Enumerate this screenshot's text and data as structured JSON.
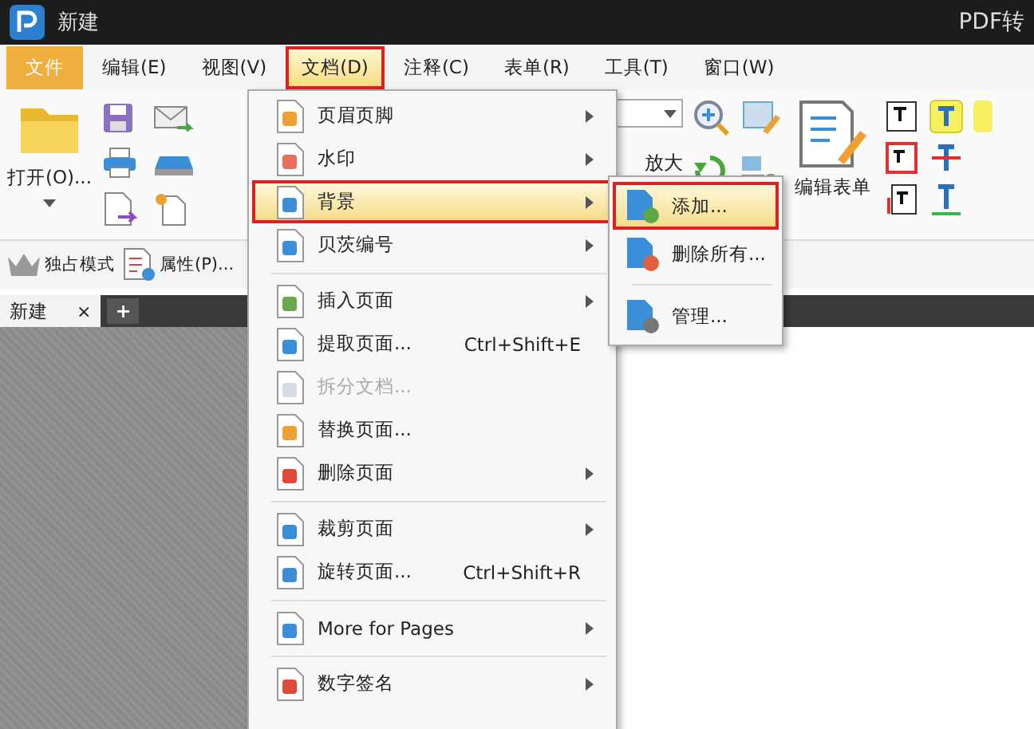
{
  "title_bar": {
    "title": "新建",
    "app_name": "PDF转"
  },
  "menu_bar": [
    {
      "label": "文件",
      "selected": false
    },
    {
      "label": "编辑(E)",
      "selected": false
    },
    {
      "label": "视图(V)",
      "selected": false
    },
    {
      "label": "文档(D)",
      "selected": true,
      "callout": true
    },
    {
      "label": "注释(C)",
      "selected": false
    },
    {
      "label": "表单(R)",
      "selected": false
    },
    {
      "label": "工具(T)",
      "selected": false
    },
    {
      "label": "窗口(W)",
      "selected": false
    }
  ],
  "ribbon": {
    "open_label": "打开(O)...",
    "zoom_label": "放大",
    "edit_form_label": "编辑表单"
  },
  "quick_bar": [
    {
      "label": "独占模式"
    },
    {
      "label": "属性(P)..."
    }
  ],
  "doc_tabs": [
    {
      "label": "新建",
      "selected": true,
      "close": "×"
    }
  ],
  "new_tab": "+",
  "document_menu": [
    {
      "kind": "item",
      "label": "页眉页脚",
      "submenu": true,
      "selected": false,
      "disabled": false
    },
    {
      "kind": "item",
      "label": "水印",
      "submenu": true,
      "selected": false,
      "disabled": false
    },
    {
      "kind": "item",
      "label": "背景",
      "submenu": true,
      "selected": true,
      "disabled": false,
      "callout": true
    },
    {
      "kind": "item",
      "label": "贝茨编号",
      "submenu": true,
      "selected": false,
      "disabled": false
    },
    {
      "kind": "separator"
    },
    {
      "kind": "item",
      "label": "插入页面",
      "submenu": true,
      "selected": false,
      "disabled": false
    },
    {
      "kind": "item",
      "label": "提取页面...",
      "shortcut": "Ctrl+Shift+E",
      "submenu": false,
      "selected": false,
      "disabled": false
    },
    {
      "kind": "item",
      "label": "拆分文档...",
      "submenu": false,
      "selected": false,
      "disabled": true
    },
    {
      "kind": "item",
      "label": "替换页面...",
      "submenu": false,
      "selected": false,
      "disabled": false
    },
    {
      "kind": "item",
      "label": "删除页面",
      "submenu": true,
      "selected": false,
      "disabled": false
    },
    {
      "kind": "separator"
    },
    {
      "kind": "item",
      "label": "裁剪页面",
      "submenu": true,
      "selected": false,
      "disabled": false
    },
    {
      "kind": "item",
      "label": "旋转页面...",
      "shortcut": "Ctrl+Shift+R",
      "submenu": false,
      "selected": false,
      "disabled": false
    },
    {
      "kind": "separator"
    },
    {
      "kind": "item",
      "label": "More for Pages",
      "submenu": true,
      "selected": false,
      "disabled": false
    },
    {
      "kind": "separator"
    },
    {
      "kind": "item",
      "label": "数字签名",
      "submenu": true,
      "selected": false,
      "disabled": false
    }
  ],
  "background_submenu": [
    {
      "kind": "item",
      "label": "添加...",
      "selected": true,
      "callout": true
    },
    {
      "kind": "item",
      "label": "删除所有...",
      "selected": false
    },
    {
      "kind": "separator"
    },
    {
      "kind": "item",
      "label": "管理...",
      "selected": false
    }
  ]
}
